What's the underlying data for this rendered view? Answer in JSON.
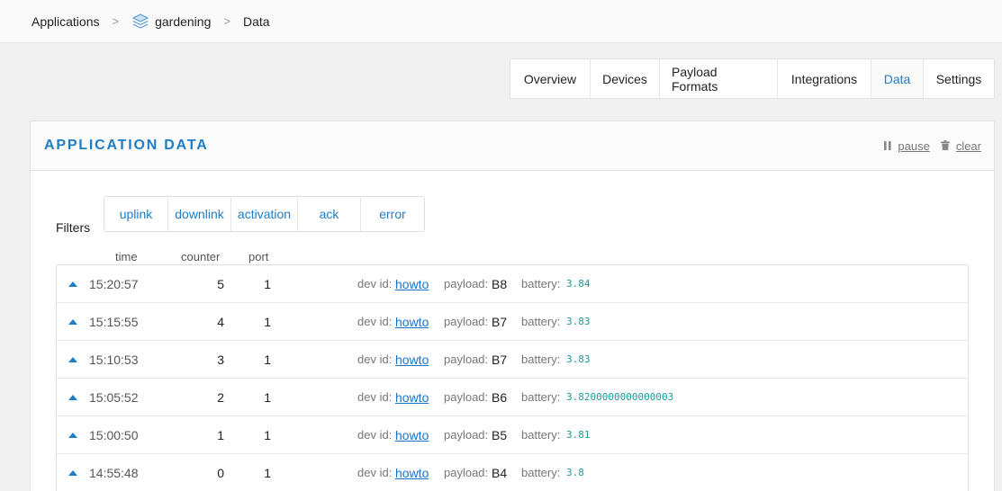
{
  "breadcrumb": {
    "root": "Applications",
    "app": "gardening",
    "current": "Data",
    "app_icon": "stack-icon"
  },
  "tabs": [
    {
      "label": "Overview",
      "active": false
    },
    {
      "label": "Devices",
      "active": false
    },
    {
      "label": "Payload Formats",
      "active": false
    },
    {
      "label": "Integrations",
      "active": false
    },
    {
      "label": "Data",
      "active": true
    },
    {
      "label": "Settings",
      "active": false
    }
  ],
  "card": {
    "title": "APPLICATION DATA",
    "pause_label": "pause",
    "clear_label": "clear"
  },
  "filters": {
    "label": "Filters",
    "items": [
      "uplink",
      "downlink",
      "activation",
      "ack",
      "error"
    ]
  },
  "columns": {
    "time": "time",
    "counter": "counter",
    "port": "port"
  },
  "field_labels": {
    "devid": "dev id:",
    "payload": "payload:",
    "battery": "battery:"
  },
  "rows": [
    {
      "time": "15:20:57",
      "counter": "5",
      "port": "1",
      "devid": "howto",
      "payload": "B8",
      "battery": "3.84"
    },
    {
      "time": "15:15:55",
      "counter": "4",
      "port": "1",
      "devid": "howto",
      "payload": "B7",
      "battery": "3.83"
    },
    {
      "time": "15:10:53",
      "counter": "3",
      "port": "1",
      "devid": "howto",
      "payload": "B7",
      "battery": "3.83"
    },
    {
      "time": "15:05:52",
      "counter": "2",
      "port": "1",
      "devid": "howto",
      "payload": "B6",
      "battery": "3.8200000000000003"
    },
    {
      "time": "15:00:50",
      "counter": "1",
      "port": "1",
      "devid": "howto",
      "payload": "B5",
      "battery": "3.81"
    },
    {
      "time": "14:55:48",
      "counter": "0",
      "port": "1",
      "devid": "howto",
      "payload": "B4",
      "battery": "3.8"
    }
  ],
  "colors": {
    "accent": "#1f7dc6",
    "battery_value": "#1a9a9a"
  }
}
